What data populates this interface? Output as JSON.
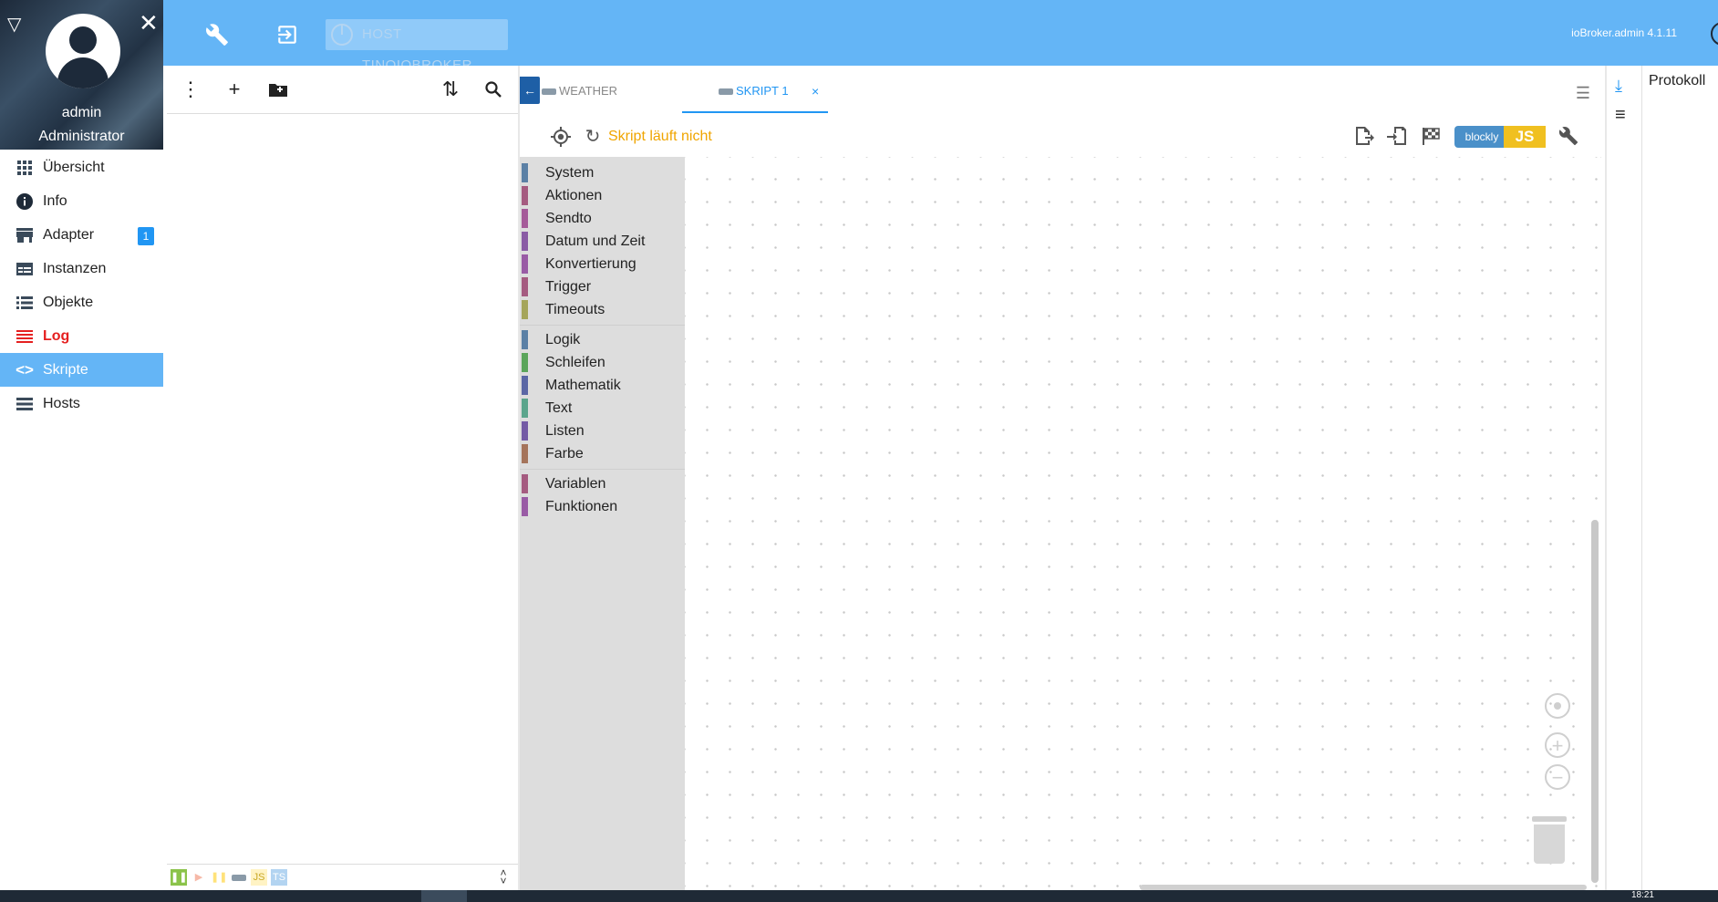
{
  "topbar": {
    "host_label": "HOST TINOIOBROKER",
    "version": "ioBroker.admin 4.1.11",
    "settings_icon": "wrench-icon",
    "logout_icon": "exit-icon"
  },
  "sidebar": {
    "user_name": "admin",
    "user_role": "Administrator",
    "items": [
      {
        "label": "Übersicht",
        "icon": "apps-grid-icon"
      },
      {
        "label": "Info",
        "icon": "info-icon"
      },
      {
        "label": "Adapter",
        "icon": "store-icon",
        "badge": "1"
      },
      {
        "label": "Instanzen",
        "icon": "instances-icon"
      },
      {
        "label": "Objekte",
        "icon": "list-icon"
      },
      {
        "label": "Log",
        "icon": "log-icon"
      },
      {
        "label": "Skripte",
        "icon": "code-icon"
      },
      {
        "label": "Hosts",
        "icon": "hosts-icon"
      }
    ]
  },
  "editor": {
    "tabs": [
      {
        "label": "WEATHER NOTIFIC"
      },
      {
        "label": "SKRIPT 1"
      }
    ],
    "status": "Skript läuft nicht",
    "blockly_label": "blockly",
    "js_label": "JS"
  },
  "toolbox": {
    "groups": [
      [
        {
          "label": "System",
          "color": "#5b80a5"
        },
        {
          "label": "Aktionen",
          "color": "#a55b80"
        },
        {
          "label": "Sendto",
          "color": "#a55b99"
        },
        {
          "label": "Datum und Zeit",
          "color": "#8a5ba5"
        },
        {
          "label": "Konvertierung",
          "color": "#995ba5"
        },
        {
          "label": "Trigger",
          "color": "#a55b80"
        },
        {
          "label": "Timeouts",
          "color": "#a5a55b"
        }
      ],
      [
        {
          "label": "Logik",
          "color": "#5b80a5"
        },
        {
          "label": "Schleifen",
          "color": "#5ba55b"
        },
        {
          "label": "Mathematik",
          "color": "#5b67a5"
        },
        {
          "label": "Text",
          "color": "#5ba58c"
        },
        {
          "label": "Listen",
          "color": "#745ba5"
        },
        {
          "label": "Farbe",
          "color": "#a5745b"
        }
      ],
      [
        {
          "label": "Variablen",
          "color": "#a55b80"
        },
        {
          "label": "Funktionen",
          "color": "#995ba5"
        }
      ]
    ]
  },
  "log": {
    "title": "Protokoll"
  },
  "taskbar": {
    "time": "18:21"
  }
}
